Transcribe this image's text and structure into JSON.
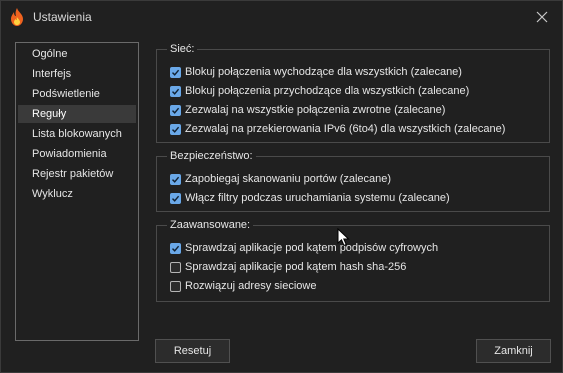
{
  "window": {
    "title": "Ustawienia"
  },
  "icons": {
    "app": "flame-icon",
    "close": "close-icon",
    "check": "checkmark-icon",
    "pointer": "mouse-pointer-icon"
  },
  "colors": {
    "accent": "#6aa8e8",
    "background": "#202020",
    "flame": "#f0631f"
  },
  "sidebar": {
    "items": [
      {
        "label": "Ogólne",
        "selected": false
      },
      {
        "label": "Interfejs",
        "selected": false
      },
      {
        "label": "Podświetlenie",
        "selected": false
      },
      {
        "label": "Reguły",
        "selected": true
      },
      {
        "label": "Lista blokowanych",
        "selected": false
      },
      {
        "label": "Powiadomienia",
        "selected": false
      },
      {
        "label": "Rejestr pakietów",
        "selected": false
      },
      {
        "label": "Wyklucz",
        "selected": false
      }
    ]
  },
  "groups": [
    {
      "title": "Sieć:",
      "options": [
        {
          "label": "Blokuj połączenia wychodzące dla wszystkich (zalecane)",
          "checked": true
        },
        {
          "label": "Blokuj połączenia przychodzące dla wszystkich (zalecane)",
          "checked": true
        },
        {
          "label": "Zezwalaj na wszystkie połączenia zwrotne (zalecane)",
          "checked": true
        },
        {
          "label": "Zezwalaj na przekierowania IPv6 (6to4) dla wszystkich (zalecane)",
          "checked": true
        }
      ]
    },
    {
      "title": "Bezpieczeństwo:",
      "options": [
        {
          "label": "Zapobiegaj skanowaniu portów (zalecane)",
          "checked": true
        },
        {
          "label": "Włącz filtry podczas uruchamiania systemu (zalecane)",
          "checked": true
        }
      ]
    },
    {
      "title": "Zaawansowane:",
      "options": [
        {
          "label": "Sprawdzaj aplikacje pod kątem podpisów cyfrowych",
          "checked": true
        },
        {
          "label": "Sprawdzaj aplikacje pod kątem hash sha-256",
          "checked": false
        },
        {
          "label": "Rozwiązuj adresy sieciowe",
          "checked": false
        }
      ]
    }
  ],
  "buttons": {
    "reset": "Resetuj",
    "close": "Zamknij"
  }
}
